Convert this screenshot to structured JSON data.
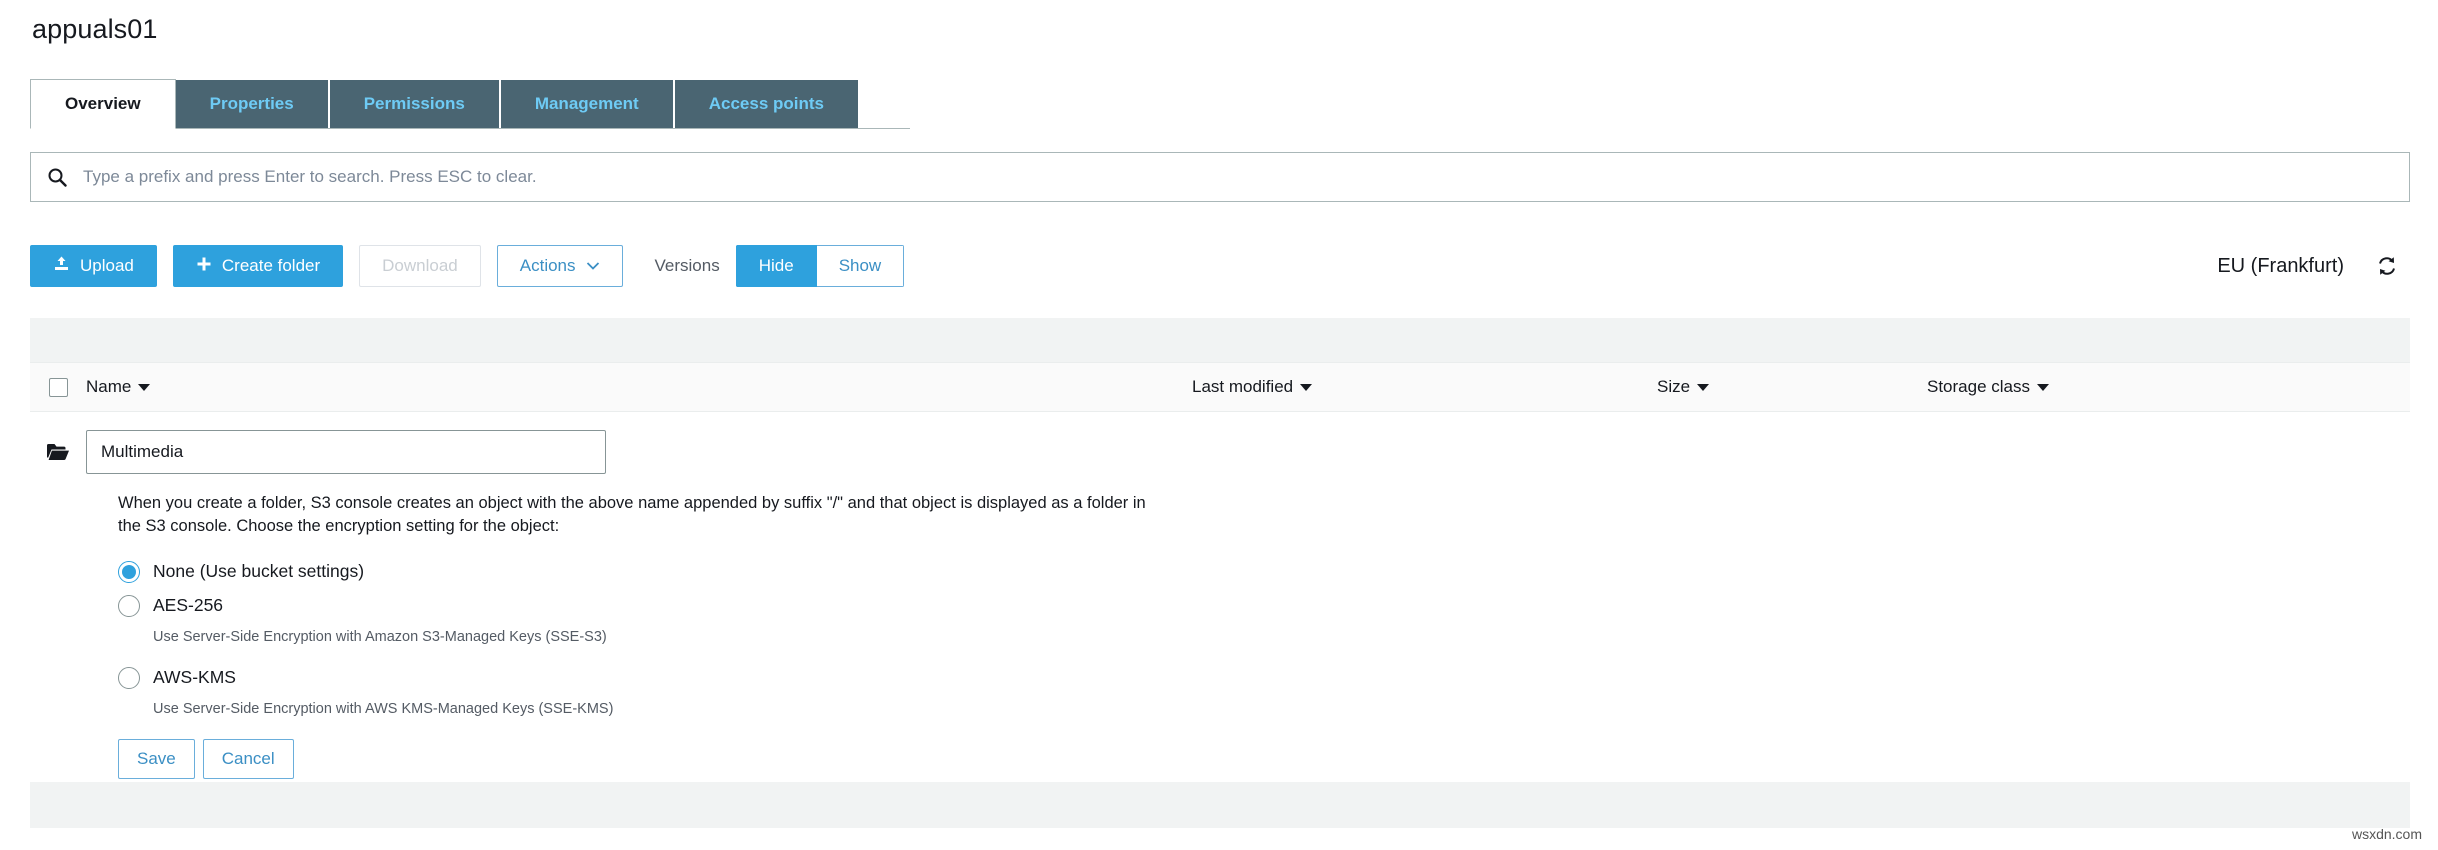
{
  "page": {
    "bucket_title": "appuals01",
    "watermark": "wsxdn.com"
  },
  "tabs": [
    {
      "label": "Overview",
      "active": true
    },
    {
      "label": "Properties",
      "active": false
    },
    {
      "label": "Permissions",
      "active": false
    },
    {
      "label": "Management",
      "active": false
    },
    {
      "label": "Access points",
      "active": false
    }
  ],
  "search": {
    "icon": "search-icon",
    "value": "",
    "placeholder": "Type a prefix and press Enter to search. Press ESC to clear."
  },
  "toolbar": {
    "upload_label": "Upload",
    "upload_icon": "upload-icon",
    "create_folder_label": "Create folder",
    "create_folder_icon": "plus-icon",
    "download_label": "Download",
    "actions_label": "Actions",
    "actions_caret_icon": "chevron-down-icon",
    "versions_label": "Versions",
    "versions_hide_label": "Hide",
    "versions_show_label": "Show",
    "versions_selected": "Hide",
    "region_label": "EU (Frankfurt)",
    "refresh_icon": "refresh-icon"
  },
  "table": {
    "columns": [
      {
        "label": "Name",
        "sort_icon": "caret-down-icon"
      },
      {
        "label": "Last modified",
        "sort_icon": "caret-down-icon"
      },
      {
        "label": "Size",
        "sort_icon": "caret-down-icon"
      },
      {
        "label": "Storage class",
        "sort_icon": "caret-down-icon"
      }
    ],
    "select_all_checked": false
  },
  "create_folder_form": {
    "folder_icon": "folder-icon",
    "folder_name_value": "Multimedia",
    "folder_name_placeholder": "",
    "help_text": "When you create a folder, S3 console creates an object with the above name appended by suffix \"/\" and that object is displayed as a folder in the S3 console. Choose the encryption setting for the object:",
    "encryption_options": [
      {
        "label": "None (Use bucket settings)",
        "description": "",
        "selected": true
      },
      {
        "label": "AES-256",
        "description": "Use Server-Side Encryption with Amazon S3-Managed Keys (SSE-S3)",
        "selected": false
      },
      {
        "label": "AWS-KMS",
        "description": "Use Server-Side Encryption with AWS KMS-Managed Keys (SSE-KMS)",
        "selected": false
      }
    ],
    "save_label": "Save",
    "cancel_label": "Cancel"
  },
  "colors": {
    "accent_blue": "#2ea1dd",
    "tab_inactive_bg": "#4a6572",
    "tab_inactive_text": "#6ecbf5",
    "link_blue": "#3b8fc4",
    "strip_grey": "#f1f3f3"
  }
}
